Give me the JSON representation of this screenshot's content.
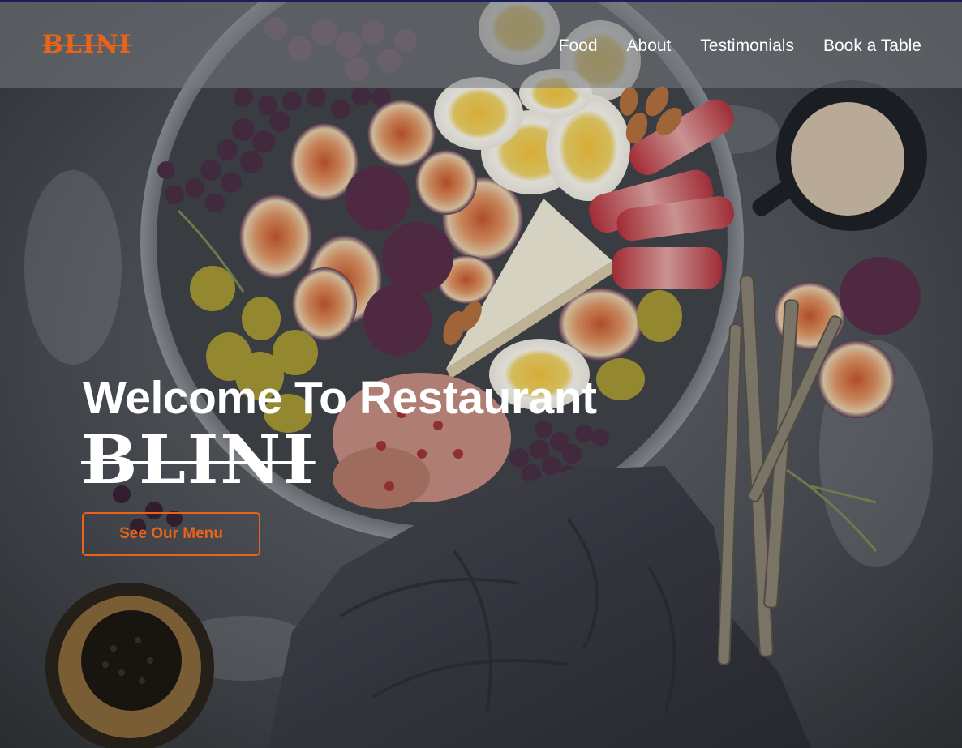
{
  "navbar": {
    "brand": "BLINI",
    "links": [
      {
        "label": "Food"
      },
      {
        "label": "About"
      },
      {
        "label": "Testimonials"
      },
      {
        "label": "Book a Table"
      }
    ]
  },
  "hero": {
    "title": "Welcome To Restaurant",
    "brand": "BLINI",
    "cta_label": "See Our Menu"
  },
  "colors": {
    "accent": "#e8641a",
    "text": "#ffffff",
    "nav_overlay": "rgba(120,124,130,0.55)",
    "top_accent": "#1a1f5c"
  }
}
